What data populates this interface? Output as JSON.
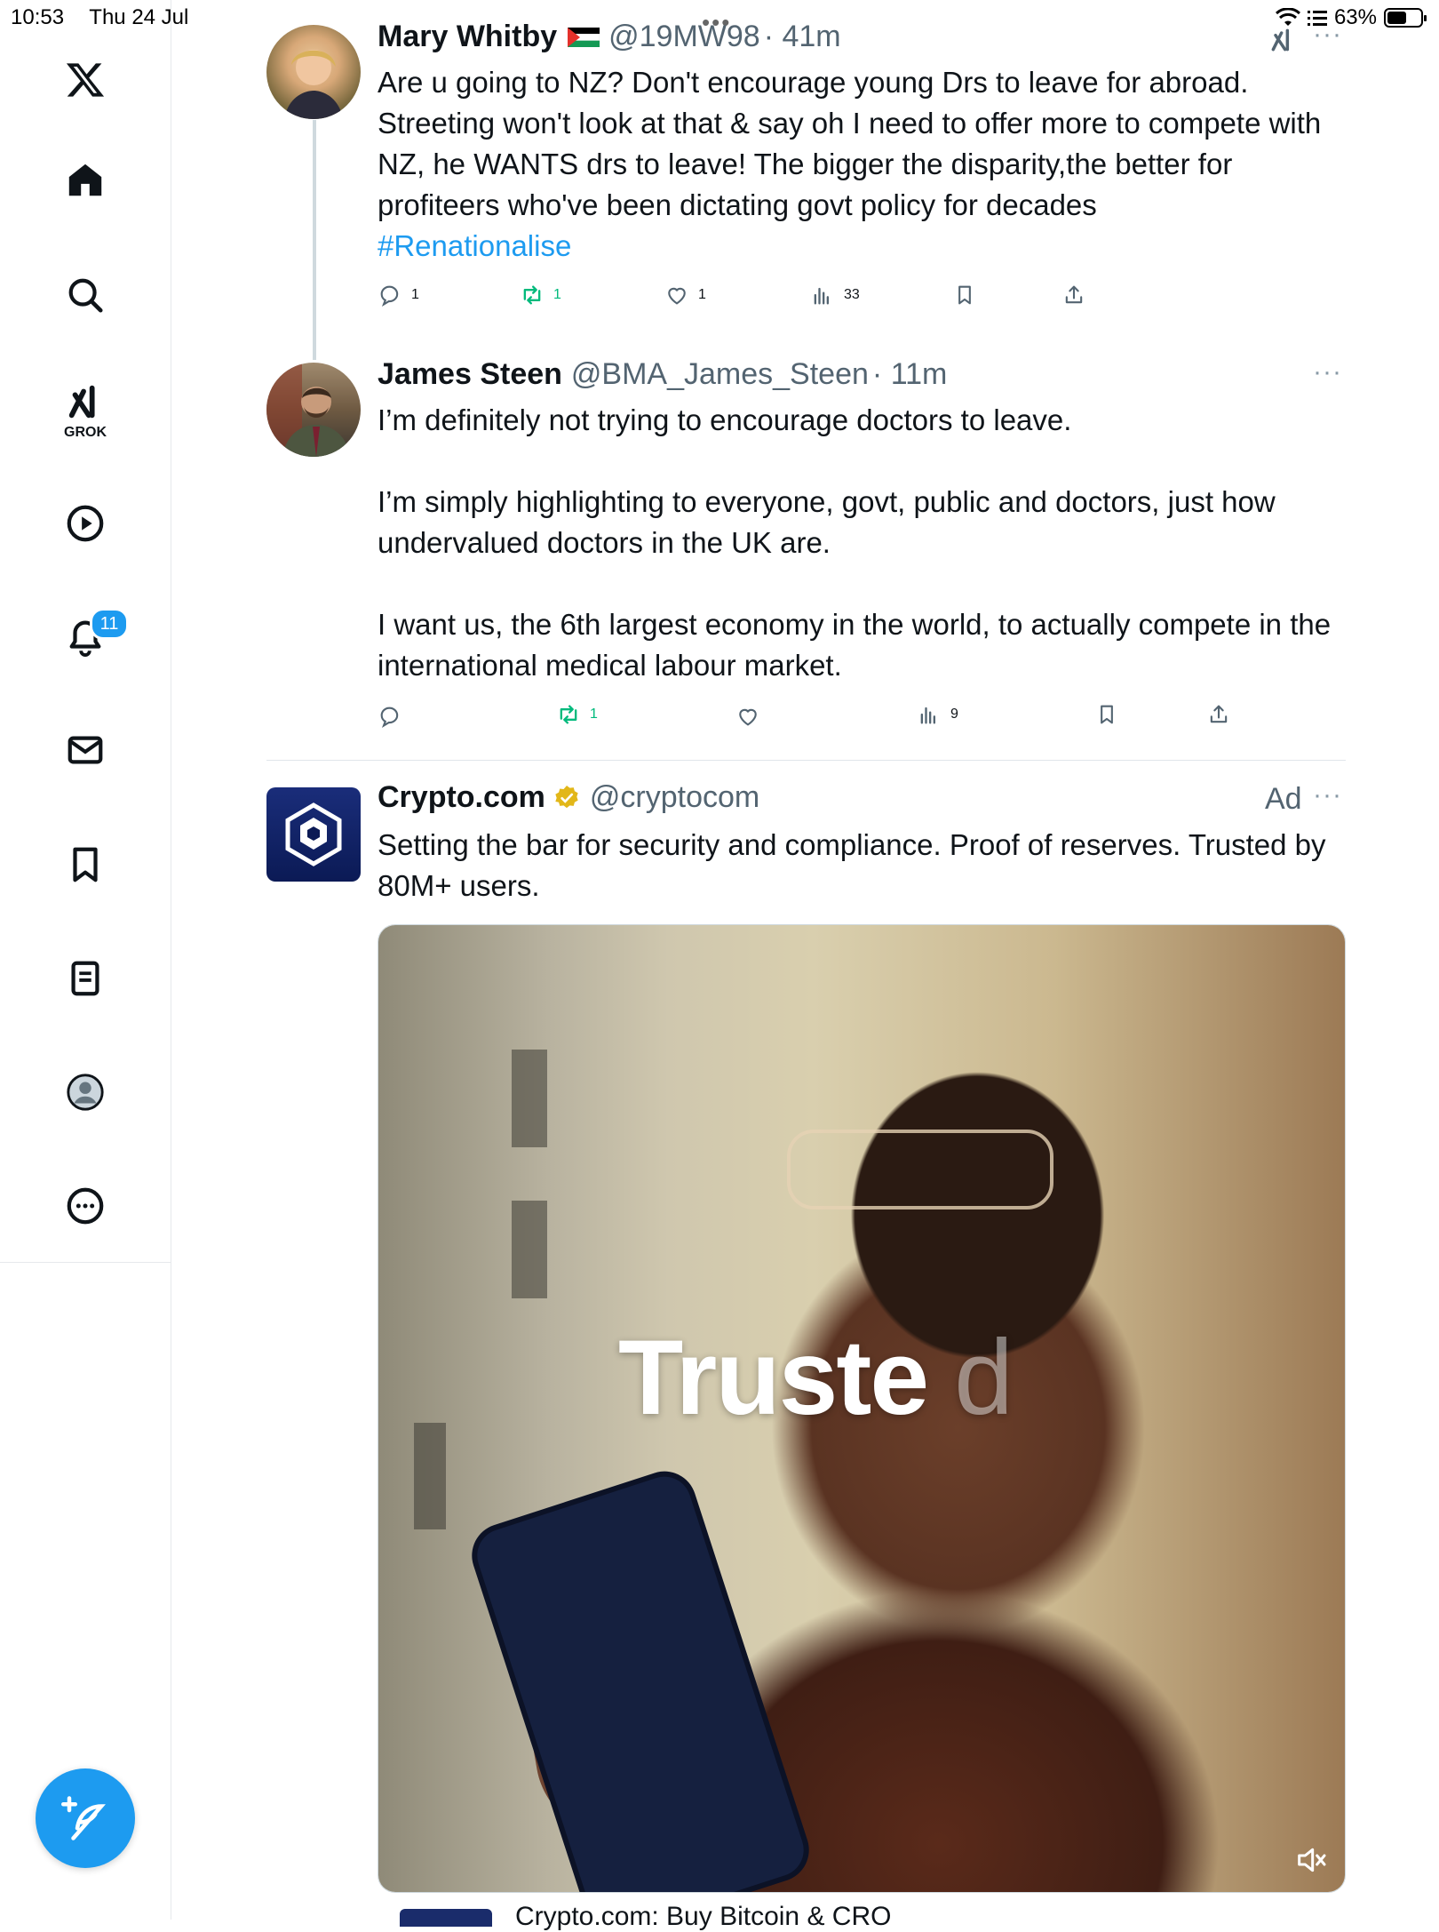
{
  "status_bar": {
    "time": "10:53",
    "date": "Thu 24 Jul",
    "battery": "63%",
    "battery_level": 0.63
  },
  "sidebar": {
    "grok_label": "GROK",
    "notifications_badge": "11"
  },
  "posts": [
    {
      "name": "Mary Whitby",
      "handle": "@19MW98",
      "time": "· 41m",
      "body_lines": [
        "Are u going to NZ? Don't encourage young Drs to leave for abroad. Streeting won't look at that & say oh I need to offer more to compete with NZ, he WANTS drs to leave! The bigger the disparity,the better for profiteers who've been dictating govt policy for decades"
      ],
      "hashtag": "#Renationalise",
      "replies": "1",
      "reposts": "1",
      "likes": "1",
      "views": "33"
    },
    {
      "name": "James Steen",
      "handle": "@BMA_James_Steen",
      "time": "· 11m",
      "paragraphs": [
        "I’m definitely not trying to encourage doctors to leave.",
        "I’m simply highlighting to everyone, govt, public and doctors, just how undervalued doctors in the UK are.",
        "I want us, the 6th largest economy in the world, to actually compete in the international medical labour market."
      ],
      "reposts": "1",
      "views": "9"
    },
    {
      "name": "Crypto.com",
      "handle": "@cryptocom",
      "ad_label": "Ad",
      "body": "Setting the bar for security and compliance. Proof of reserves. Trusted by 80M+ users.",
      "media_text_main": "Truste",
      "media_text_faint": "d",
      "card_title": "Crypto.com: Buy Bitcoin & CRO"
    }
  ]
}
